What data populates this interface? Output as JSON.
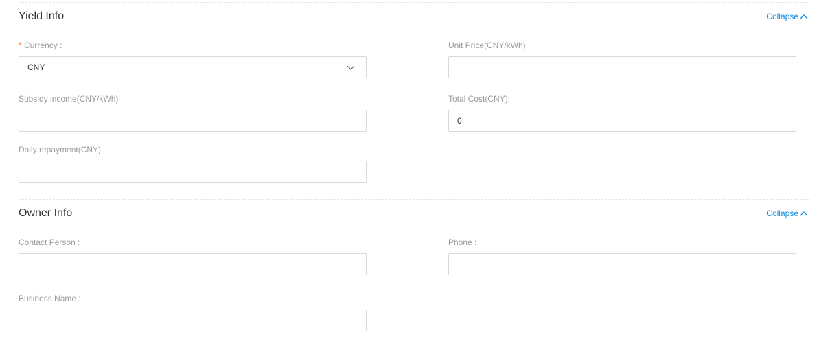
{
  "yield_info": {
    "title": "Yield Info",
    "collapse_label": "Collapse",
    "currency": {
      "required_mark": "*",
      "label": "Currency :",
      "value": "CNY"
    },
    "unit_price": {
      "label": "Unit Price(CNY/kWh)",
      "value": ""
    },
    "subsidy_income": {
      "label": "Subsidy income(CNY/kWh)",
      "value": ""
    },
    "total_cost": {
      "label": "Total Cost(CNY):",
      "value": "0"
    },
    "daily_repayment": {
      "label": "Daily repayment(CNY)",
      "value": ""
    }
  },
  "owner_info": {
    "title": "Owner Info",
    "collapse_label": "Collapse",
    "contact_person": {
      "label": "Contact Person :",
      "value": ""
    },
    "phone": {
      "label": "Phone :",
      "value": ""
    },
    "business_name": {
      "label": "Business Name :",
      "value": ""
    }
  },
  "colors": {
    "accent": "#1a8fe3",
    "required": "#f5812a",
    "label": "#9b9b9b",
    "border": "#d9d9d9"
  },
  "icons": {
    "collapse": "chevron-up-icon",
    "select": "chevron-down-icon"
  }
}
